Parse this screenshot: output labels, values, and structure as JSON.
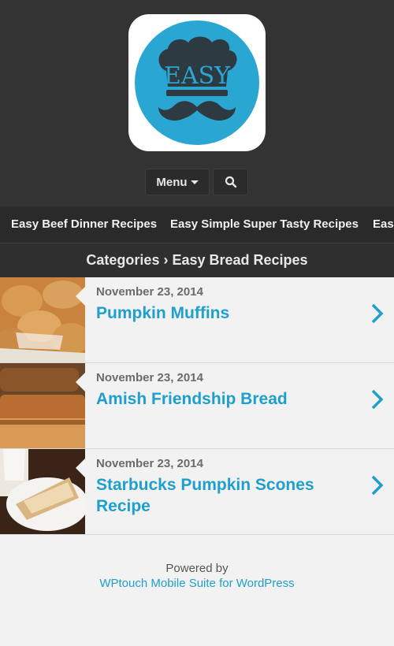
{
  "logo": {
    "text": "EASY",
    "bg_color": "#2aa6d3"
  },
  "header": {
    "menu_label": "Menu"
  },
  "categories_strip": [
    "Easy Beef Dinner Recipes",
    "Easy Simple Super Tasty Recipes",
    "Easy"
  ],
  "breadcrumb": "Categories › Easy Bread Recipes",
  "posts": [
    {
      "date": "November 23, 2014",
      "title": "Pumpkin Muffins"
    },
    {
      "date": "November 23, 2014",
      "title": "Amish Friendship Bread"
    },
    {
      "date": "November 23, 2014",
      "title": "Starbucks Pumpkin Scones Recipe"
    }
  ],
  "footer": {
    "powered_by": "Powered by",
    "link_text": "WPtouch Mobile Suite for WordPress"
  },
  "colors": {
    "accent": "#1f9fcc",
    "header_bg": "#333333"
  }
}
